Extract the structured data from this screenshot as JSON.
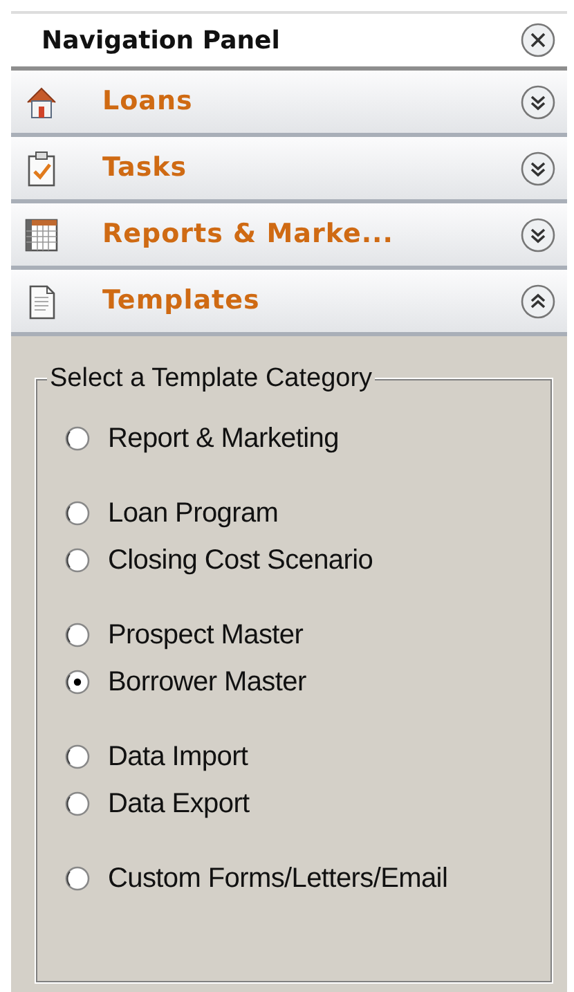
{
  "panel": {
    "title": "Navigation Panel"
  },
  "sections": [
    {
      "kind": "house",
      "label": "Loans",
      "expanded": false
    },
    {
      "kind": "clipboard",
      "label": "Tasks",
      "expanded": false
    },
    {
      "kind": "grid",
      "label": "Reports & Marke...",
      "expanded": false
    },
    {
      "kind": "document",
      "label": "Templates",
      "expanded": true
    }
  ],
  "template_category": {
    "legend": "Select a Template Category",
    "groups": [
      {
        "options": [
          {
            "label": "Report & Marketing",
            "selected": false
          }
        ]
      },
      {
        "options": [
          {
            "label": "Loan Program",
            "selected": false
          },
          {
            "label": "Closing Cost Scenario",
            "selected": false
          }
        ]
      },
      {
        "options": [
          {
            "label": "Prospect Master",
            "selected": false
          },
          {
            "label": "Borrower Master",
            "selected": true
          }
        ]
      },
      {
        "options": [
          {
            "label": "Data Import",
            "selected": false
          },
          {
            "label": "Data Export",
            "selected": false
          }
        ]
      },
      {
        "options": [
          {
            "label": "Custom Forms/Letters/Email",
            "selected": false
          }
        ]
      }
    ]
  }
}
